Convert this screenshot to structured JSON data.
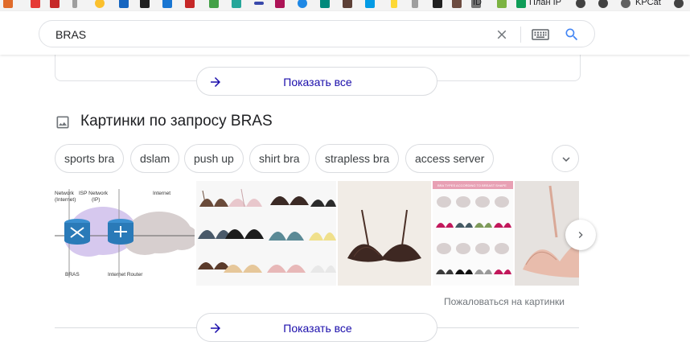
{
  "bookmarks": {
    "items": [
      {
        "icon": "bookmark-icon",
        "label": ""
      },
      {
        "icon": "yandex-icon",
        "label": ""
      },
      {
        "icon": "bookmark-icon",
        "label": ""
      },
      {
        "icon": "bookmark-icon",
        "label": "ID"
      },
      {
        "icon": "sheets-icon",
        "label": "План IP"
      },
      {
        "icon": "globe-icon",
        "label": "KPCat"
      }
    ]
  },
  "search": {
    "query": "BRAS",
    "clear_icon": "close-icon",
    "keyboard_icon": "keyboard-icon",
    "search_icon": "search-icon"
  },
  "show_all_label": "Показать все",
  "images_section": {
    "title": "Картинки по запросу BRAS",
    "chips": [
      "sports bra",
      "dslam",
      "push up",
      "shirt bra",
      "strapless bra",
      "access server"
    ],
    "diagram_labels": {
      "network": "Network\n(Internet)",
      "isp": "ISP Network\n(IP)",
      "internet": "Internet",
      "bras": "BRAS",
      "router": "Internet Router"
    },
    "report_link": "Пожаловаться на картинки",
    "chart_title": "BRA TYPES ACCORDING TO BREAST SHAPE"
  },
  "colors": {
    "link_blue": "#1a0dab",
    "google_blue": "#4285f4",
    "border": "#dadce0"
  }
}
